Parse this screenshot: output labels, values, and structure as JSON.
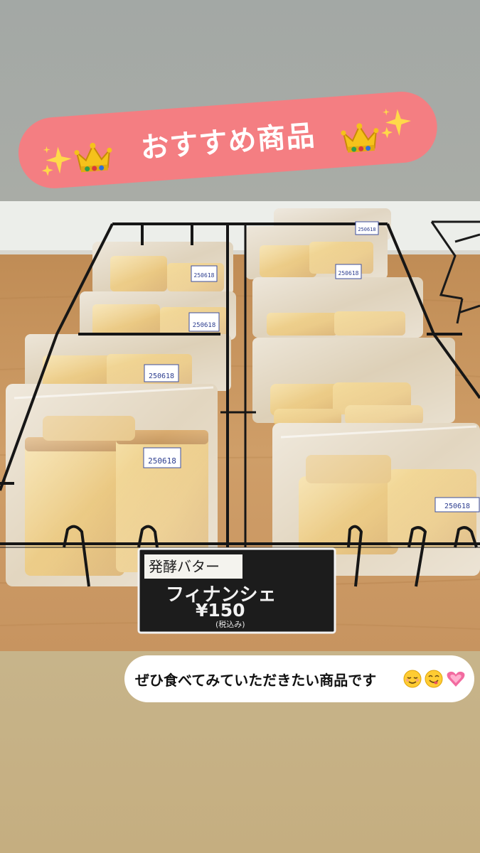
{
  "banner": {
    "title": "おすすめ商品",
    "color": "#f47e82",
    "decorations": [
      "sparkles-icon",
      "crown-icon",
      "crown-icon",
      "sparkles-icon"
    ]
  },
  "price_card": {
    "subtitle": "発酵バター",
    "product_name": "フィナンシェ",
    "price": "¥150",
    "tax_note": "(税込み)"
  },
  "package_labels": [
    "250618",
    "250618",
    "250618",
    "250618",
    "250618",
    "250618",
    "250618"
  ],
  "caption": {
    "text": "ぜひ食べてみていただきたい商品です",
    "emojis": [
      "relieved-face-icon",
      "yum-face-icon",
      "growing-heart-icon"
    ]
  }
}
